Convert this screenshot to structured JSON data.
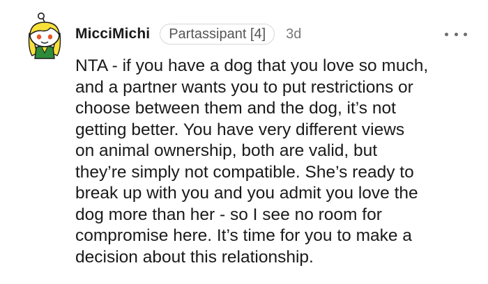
{
  "comment": {
    "author": "MicciMichi",
    "flair": "Partassipant [4]",
    "age": "3d",
    "more_icon": "more-horizontal-icon",
    "avatar_icon": "snoo-avatar-icon",
    "body": "NTA - if you have a dog that you love so much,\nand a partner wants you to put restrictions or\nchoose between them and the dog, it’s not\ngetting better. You have very different views\non animal ownership, both are valid, but\nthey’re simply not compatible. She’s ready to\nbreak up with you and you admit you love the\ndog more than her - so I see no room for\ncompromise here. It’s time for you to make a\ndecision about this relationship."
  },
  "colors": {
    "avatar_yellow": "#f7e03a",
    "avatar_green": "#2e8b3a",
    "text": "#1a1a1b",
    "meta": "#777777"
  }
}
